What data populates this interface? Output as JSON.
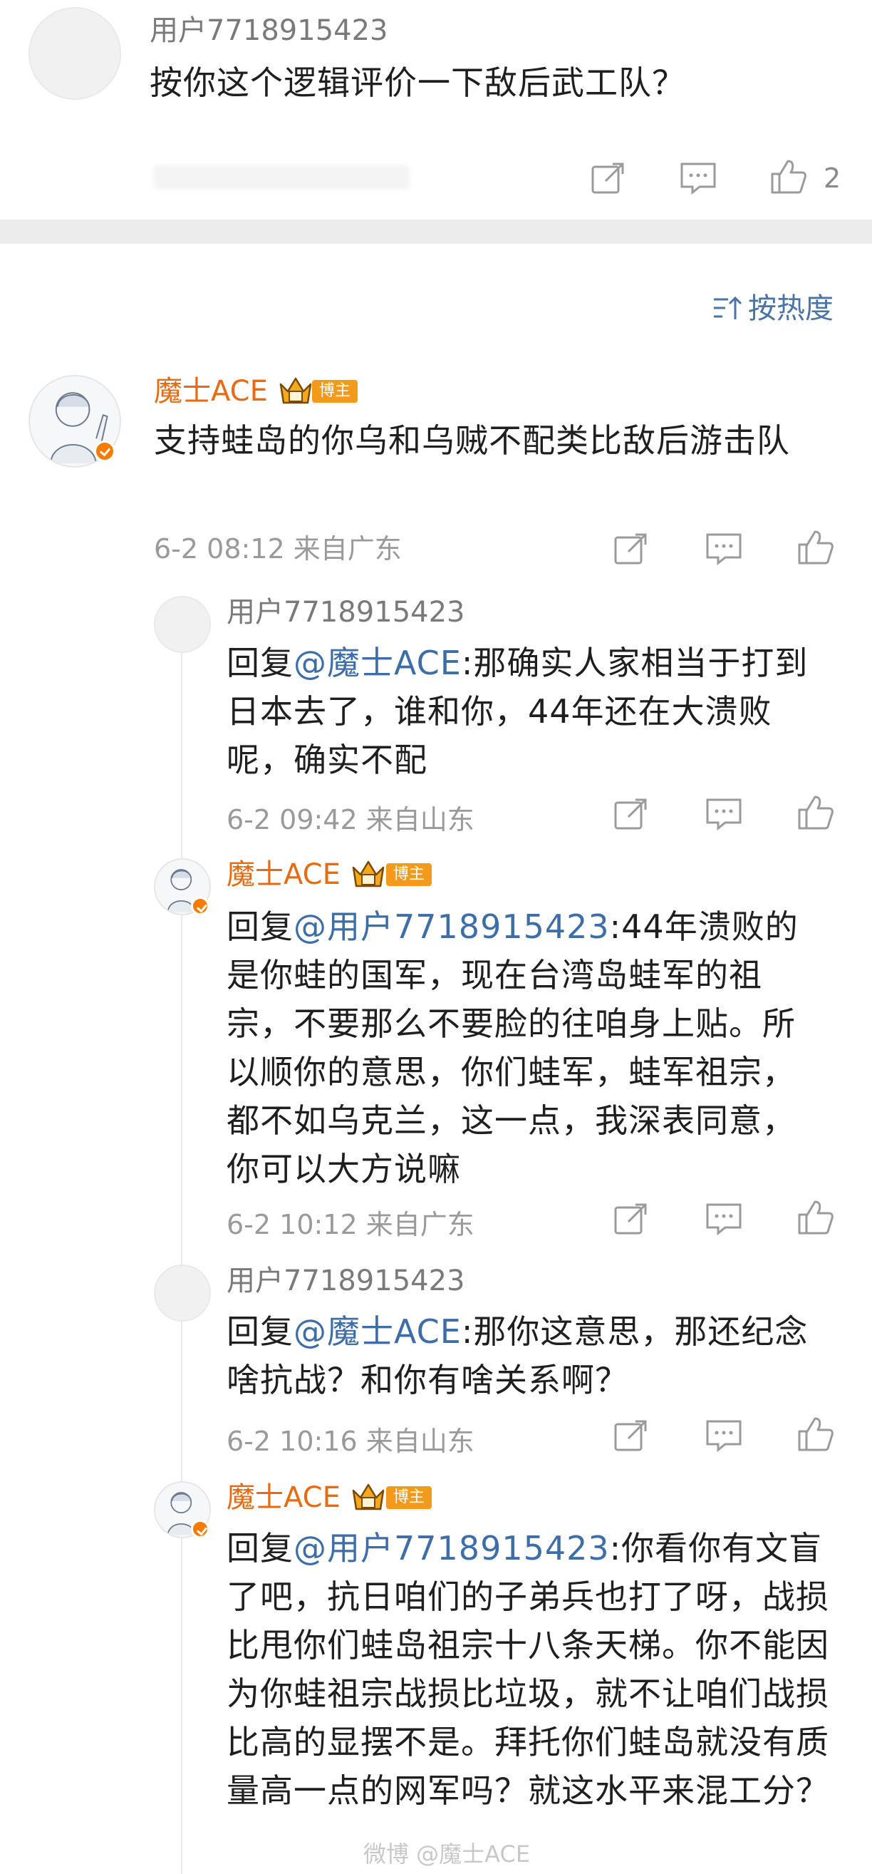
{
  "top_comment": {
    "username": "用户7718915423",
    "text": "按你这个逻辑评价一下敌后武工队？",
    "like_count": "2"
  },
  "sort": {
    "label": "按热度"
  },
  "main_comment": {
    "username": "魔士ACE",
    "badge": "博主",
    "text": "支持蛙岛的你乌和乌贼不配类比敌后游击队",
    "meta": "6-2 08:12 来自广东"
  },
  "replies": [
    {
      "username": "用户7718915423",
      "prefix": "回复",
      "mention": "@魔士ACE",
      "text": ":那确实人家相当于打到日本去了，谁和你，44年还在大溃败呢，确实不配",
      "meta": "6-2 09:42 来自山东"
    },
    {
      "username": "魔士ACE",
      "badge": "博主",
      "prefix": "回复",
      "mention": "@用户7718915423",
      "text": ":44年溃败的是你蛙的国军，现在台湾岛蛙军的祖宗，不要那么不要脸的往咱身上贴。所以顺你的意思，你们蛙军，蛙军祖宗，都不如乌克兰，这一点，我深表同意，你可以大方说嘛",
      "meta": "6-2 10:12 来自广东"
    },
    {
      "username": "用户7718915423",
      "prefix": "回复",
      "mention": "@魔士ACE",
      "text": ":那你这意思，那还纪念啥抗战？和你有啥关系啊？",
      "meta": "6-2 10:16 来自山东"
    },
    {
      "username": "魔士ACE",
      "badge": "博主",
      "prefix": "回复",
      "mention": "@用户7718915423",
      "text": ":你看你有文盲了吧，抗日咱们的子弟兵也打了呀，战损比甩你们蛙岛祖宗十八条天梯。你不能因为你蛙祖宗战损比垃圾，就不让咱们战损比高的显摆不是。拜托你们蛙岛就没有质量高一点的网军吗？就这水平来混工分？"
    }
  ],
  "watermark": "微博 @魔士ACE",
  "colors": {
    "orange_name": "#e86b12",
    "mention_blue": "#3e6ea8",
    "badge_orange": "#f39a1b",
    "meta_gray": "#9a9a9a"
  }
}
